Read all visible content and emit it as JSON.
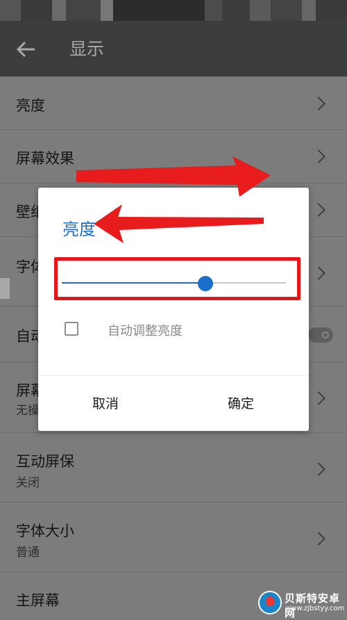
{
  "app_bar": {
    "title": "显示",
    "back_icon": "arrow-left-icon"
  },
  "settings": {
    "items": [
      {
        "title": "亮度",
        "subtitle": ""
      },
      {
        "title": "屏幕效果",
        "subtitle": ""
      },
      {
        "title": "壁纸",
        "subtitle": ""
      },
      {
        "title": "字体",
        "subtitle": ""
      },
      {
        "title": "自动",
        "subtitle": ""
      },
      {
        "title": "屏幕",
        "subtitle": "无操"
      },
      {
        "title": "互动屏保",
        "subtitle": "关闭"
      },
      {
        "title": "字体大小",
        "subtitle": "普通"
      },
      {
        "title": "主屏幕",
        "subtitle": ""
      }
    ]
  },
  "brightness_dialog": {
    "title": "亮度",
    "slider_level": 0.64,
    "auto_brightness_label": "自动调整亮度",
    "auto_brightness_checked": false,
    "cancel_label": "取消",
    "confirm_label": "确定"
  },
  "colors": {
    "accent": "#1a6fcb",
    "highlight": "#e41717",
    "appbar": "#3b3e3c"
  },
  "watermark": {
    "name": "贝斯特安卓网",
    "url": "www.zjbstyy.com"
  }
}
